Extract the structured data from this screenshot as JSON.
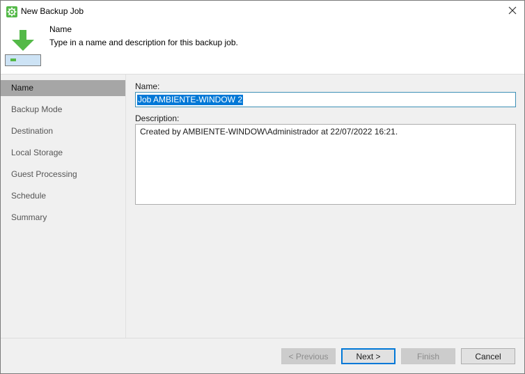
{
  "window": {
    "title": "New Backup Job",
    "accent_color": "#54b948",
    "app_icon": "gear-icon",
    "close_icon": "close-icon"
  },
  "header": {
    "title": "Name",
    "subtitle": "Type in a name and description for this backup job.",
    "icon": "download-arrow-icon"
  },
  "sidebar": {
    "items": [
      {
        "label": "Name",
        "active": true
      },
      {
        "label": "Backup Mode",
        "active": false
      },
      {
        "label": "Destination",
        "active": false
      },
      {
        "label": "Local Storage",
        "active": false
      },
      {
        "label": "Guest Processing",
        "active": false
      },
      {
        "label": "Schedule",
        "active": false
      },
      {
        "label": "Summary",
        "active": false
      }
    ]
  },
  "form": {
    "name_label": "Name:",
    "name_value": "Job AMBIENTE-WINDOW 2",
    "description_label": "Description:",
    "description_value": "Created by AMBIENTE-WINDOW\\Administrador at 22/07/2022 16:21."
  },
  "buttons": {
    "previous": "< Previous",
    "next": "Next >",
    "finish": "Finish",
    "cancel": "Cancel"
  }
}
